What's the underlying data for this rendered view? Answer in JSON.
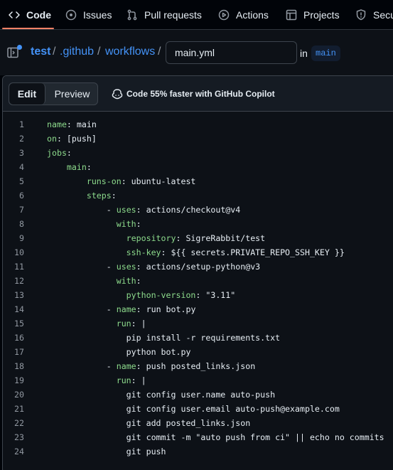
{
  "nav": {
    "tabs": [
      {
        "label": "Code",
        "icon": "code-icon"
      },
      {
        "label": "Issues",
        "icon": "issue-icon"
      },
      {
        "label": "Pull requests",
        "icon": "pull-request-icon"
      },
      {
        "label": "Actions",
        "icon": "play-icon"
      },
      {
        "label": "Projects",
        "icon": "table-icon"
      },
      {
        "label": "Secu",
        "icon": "shield-icon"
      }
    ]
  },
  "breadcrumb": {
    "repo": "test",
    "dir1": ".github",
    "dir2": "workflows",
    "separator": "/",
    "filename": "main.yml",
    "in_label": "in",
    "branch": "main"
  },
  "editor": {
    "edit_label": "Edit",
    "preview_label": "Preview",
    "copilot_label": "Code 55% faster with GitHub Copilot",
    "lines": [
      {
        "n": "1",
        "k": "name",
        "v": " main"
      },
      {
        "n": "2",
        "k": "on",
        "v": " [push]"
      },
      {
        "n": "3",
        "k": "jobs",
        "v": ""
      },
      {
        "n": "4",
        "k": "    main",
        "v": ""
      },
      {
        "n": "5",
        "k": "        runs-on",
        "v": " ubuntu-latest"
      },
      {
        "n": "6",
        "k": "        steps",
        "v": ""
      },
      {
        "n": "7",
        "p": "            - ",
        "k": "uses",
        "v": " actions/checkout@v4"
      },
      {
        "n": "8",
        "k": "              with",
        "v": ""
      },
      {
        "n": "9",
        "k": "                repository",
        "v": " SigreRabbit/test"
      },
      {
        "n": "10",
        "k": "                ssh-key",
        "v": " ${{ secrets.PRIVATE_REPO_SSH_KEY }}"
      },
      {
        "n": "11",
        "p": "            - ",
        "k": "uses",
        "v": " actions/setup-python@v3"
      },
      {
        "n": "12",
        "k": "              with",
        "v": ""
      },
      {
        "n": "13",
        "k": "                python-version",
        "v": " \"3.11\""
      },
      {
        "n": "14",
        "p": "            - ",
        "k": "name",
        "v": " run bot.py"
      },
      {
        "n": "15",
        "k": "              run",
        "v": " |"
      },
      {
        "n": "16",
        "t": "                pip install -r requirements.txt"
      },
      {
        "n": "17",
        "t": "                python bot.py"
      },
      {
        "n": "18",
        "p": "            - ",
        "k": "name",
        "v": " push posted_links.json"
      },
      {
        "n": "19",
        "k": "              run",
        "v": " |"
      },
      {
        "n": "20",
        "t": "                git config user.name auto-push"
      },
      {
        "n": "21",
        "t": "                git config user.email auto-push@example.com"
      },
      {
        "n": "22",
        "t": "                git add posted_links.json"
      },
      {
        "n": "23",
        "t": "                git commit -m \"auto push from ci\" || echo no commits"
      },
      {
        "n": "24",
        "t": "                git push"
      }
    ]
  },
  "colors": {
    "accent_underline": "#f78166",
    "link": "#4493f8",
    "yaml_key": "#8ddb8c"
  }
}
